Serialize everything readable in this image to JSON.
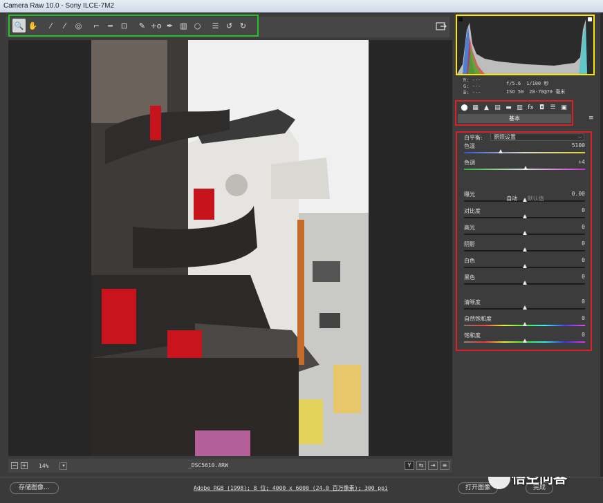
{
  "window": {
    "title": "Camera Raw 10.0 - Sony ILCE-7M2"
  },
  "toolbar": {
    "tools": [
      {
        "icon": "zoom-icon",
        "glyph": "🔍",
        "active": true
      },
      {
        "icon": "hand-icon",
        "glyph": "✋"
      },
      {
        "icon": "white-balance-icon",
        "glyph": "⁄",
        "gap": true
      },
      {
        "icon": "color-sampler-icon",
        "glyph": "⁄"
      },
      {
        "icon": "targeted-adjust-icon",
        "glyph": "◎"
      },
      {
        "icon": "crop-icon",
        "glyph": "⌐",
        "gap": true
      },
      {
        "icon": "straighten-icon",
        "glyph": "═"
      },
      {
        "icon": "transform-icon",
        "glyph": "⊡"
      },
      {
        "icon": "spot-removal-icon",
        "glyph": "✎",
        "gap": true
      },
      {
        "icon": "red-eye-icon",
        "glyph": "+o"
      },
      {
        "icon": "adjustment-brush-icon",
        "glyph": "✒"
      },
      {
        "icon": "graduated-filter-icon",
        "glyph": "▥"
      },
      {
        "icon": "radial-filter-icon",
        "glyph": "○"
      },
      {
        "icon": "preferences-icon",
        "glyph": "☰",
        "gap": true
      },
      {
        "icon": "rotate-ccw-icon",
        "glyph": "↺"
      },
      {
        "icon": "rotate-cw-icon",
        "glyph": "↻"
      }
    ]
  },
  "canvas": {
    "zoom": "14%",
    "filename": "_DSC5610.ARW"
  },
  "readout": {
    "r": "R: ---",
    "g": "G: ---",
    "b": "B: ---",
    "aperture": "f/5.6",
    "shutter": "1/100 秒",
    "iso": "ISO 50",
    "lens": "28-70@70 毫米"
  },
  "panel": {
    "tabs": [
      "basic",
      "tone-curve",
      "detail",
      "hsl",
      "split-toning",
      "lens",
      "fx",
      "camera-calibration",
      "presets",
      "snapshots"
    ],
    "name": "基本"
  },
  "basic": {
    "wb_label": "白平衡:",
    "wb_value": "原照设置",
    "auto": "自动",
    "default": "默认值",
    "sliders": [
      {
        "key": "temp",
        "label": "色温",
        "value": "5100",
        "pos": 0.3
      },
      {
        "key": "tint",
        "label": "色调",
        "value": "+4",
        "pos": 0.51
      },
      {
        "key": "exposure",
        "label": "曝光",
        "value": "0.00",
        "pos": 0.5
      },
      {
        "key": "contrast",
        "label": "对比度",
        "value": "0",
        "pos": 0.5
      },
      {
        "key": "highlights",
        "label": "高光",
        "value": "0",
        "pos": 0.5
      },
      {
        "key": "shadows",
        "label": "阴影",
        "value": "0",
        "pos": 0.5
      },
      {
        "key": "whites",
        "label": "白色",
        "value": "0",
        "pos": 0.5
      },
      {
        "key": "blacks",
        "label": "黑色",
        "value": "0",
        "pos": 0.5
      },
      {
        "key": "clarity",
        "label": "清晰度",
        "value": "0",
        "pos": 0.5
      },
      {
        "key": "vibrance",
        "label": "自然饱和度",
        "value": "0",
        "pos": 0.5
      },
      {
        "key": "saturation",
        "label": "饱和度",
        "value": "0",
        "pos": 0.5
      }
    ]
  },
  "footer": {
    "save": "存储图像...",
    "workflow": "Adobe RGB (1998); 8 位; 4000 x 6000 (24.0 百万像素); 300 ppi",
    "open": "打开图像",
    "done": "完成"
  },
  "watermark": "悟空问答"
}
